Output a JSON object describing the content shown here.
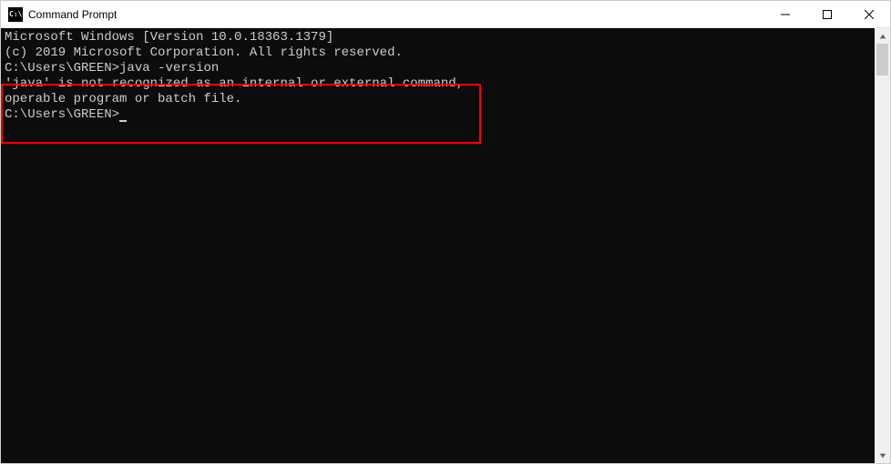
{
  "titlebar": {
    "icon_text": "C:\\",
    "title": "Command Prompt"
  },
  "terminal": {
    "line1": "Microsoft Windows [Version 10.0.18363.1379]",
    "line2": "(c) 2019 Microsoft Corporation. All rights reserved.",
    "blank1": "",
    "prompt1_path": "C:\\Users\\GREEN>",
    "prompt1_cmd": "java -version",
    "error1": "'java' is not recognized as an internal or external command,",
    "error2": "operable program or batch file.",
    "blank2": "",
    "prompt2_path": "C:\\Users\\GREEN>"
  }
}
